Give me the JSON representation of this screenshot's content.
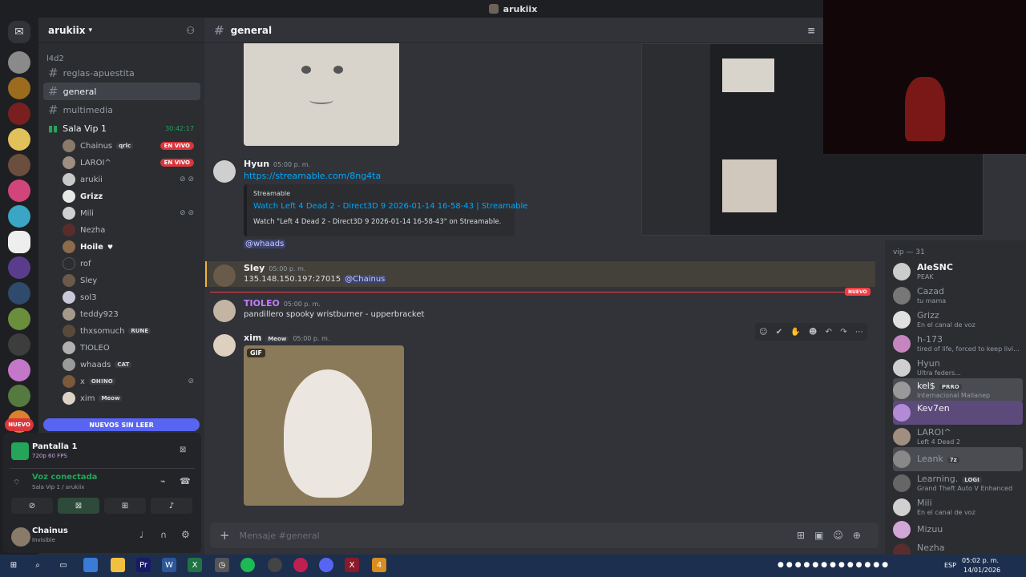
{
  "window": {
    "title": "arukiix"
  },
  "server": {
    "name": "arukiix",
    "category": "l4d2"
  },
  "channels": [
    {
      "name": "reglas-apuestita"
    },
    {
      "name": "general"
    },
    {
      "name": "multimedia"
    }
  ],
  "voice_channel": {
    "name": "Sala Vip 1",
    "timer": "30:42:17"
  },
  "voice_users": [
    {
      "name": "Chainus",
      "tag": "qrlc",
      "live": "EN VIVO"
    },
    {
      "name": "LAROI^",
      "tag": "",
      "live": "EN VIVO"
    },
    {
      "name": "arukii",
      "tag": "",
      "live": ""
    },
    {
      "name": "Grizz",
      "tag": "",
      "live": ""
    },
    {
      "name": "Mili",
      "tag": "",
      "live": ""
    },
    {
      "name": "Nezha",
      "tag": "",
      "live": ""
    },
    {
      "name": "Hoile",
      "tag": "",
      "live": ""
    },
    {
      "name": "rof",
      "tag": "",
      "live": ""
    },
    {
      "name": "Sley",
      "tag": "",
      "live": ""
    },
    {
      "name": "sol3",
      "tag": "",
      "live": ""
    },
    {
      "name": "teddy923",
      "tag": "",
      "live": ""
    },
    {
      "name": "thxsomuch",
      "tag": "RUNE",
      "live": ""
    },
    {
      "name": "TIOLEO",
      "tag": "",
      "live": ""
    },
    {
      "name": "whaads",
      "tag": "CAT",
      "live": ""
    },
    {
      "name": "x",
      "tag": "OH!NO",
      "live": ""
    },
    {
      "name": "xim",
      "tag": "Meow",
      "live": ""
    }
  ],
  "unread_label": "NUEVOS SIN LEER",
  "unread_badge": "NUEVO",
  "stream_panel": {
    "title": "Pantalla 1",
    "quality": "720p 60 FPS"
  },
  "voice_status": {
    "title": "Voz conectada",
    "sub": "Sala Vip 1 / arukiix"
  },
  "user": {
    "name": "Chainus",
    "status": "Invisible"
  },
  "chat": {
    "channel": "general",
    "messages": [
      {
        "author": "Hyun",
        "time": "05:00 p. m.",
        "link": "https://streamable.com/8ng4ta",
        "embed": {
          "provider": "Streamable",
          "title": "Watch Left 4 Dead 2 - Direct3D 9 2026-01-14 16-58-43 | Streamable",
          "desc": "Watch \"Left 4 Dead 2 - Direct3D 9 2026-01-14 16-58-43\" on Streamable."
        },
        "mention": "@whaads"
      },
      {
        "author": "Sley",
        "time": "05:00 p. m.",
        "text": "135.148.150.197:27015",
        "mention": "@Chainus"
      },
      {
        "author": "TIOLEO",
        "time": "05:00 p. m.",
        "text": "pandillero spooky wristburner - upperbracket"
      },
      {
        "author": "xim",
        "tag": "Meow",
        "time": "05:00 p. m.",
        "gif_label": "GIF"
      }
    ],
    "new_divider": "NUEVO",
    "composer_placeholder": "Mensaje #general"
  },
  "members": {
    "header": "vip — 31",
    "list": [
      {
        "name": "AleSNC",
        "status": "PEAK"
      },
      {
        "name": "Cazad",
        "status": "tu mama"
      },
      {
        "name": "Grizz",
        "status": "En el canal de voz"
      },
      {
        "name": "h-173",
        "status": "tired of life, forced to keep livi..."
      },
      {
        "name": "Hyun",
        "status": "Ultra feders..."
      },
      {
        "name": "kel$",
        "status": "Internacional Mallanep",
        "tag": "PRRO"
      },
      {
        "name": "Kev7en",
        "status": ""
      },
      {
        "name": "LAROI^",
        "status": "Left 4 Dead 2"
      },
      {
        "name": "Leank",
        "status": "",
        "tag": "7z"
      },
      {
        "name": "Learning.",
        "status": "Grand Theft Auto V Enhanced",
        "tag": "LOGI"
      },
      {
        "name": "Mili",
        "status": "En el canal de voz"
      },
      {
        "name": "Mizuu",
        "status": ""
      },
      {
        "name": "Nezha",
        "status": ""
      }
    ]
  },
  "taskbar": {
    "lang": "ESP",
    "time": "05:02 p. m.",
    "date": "14/01/2026"
  }
}
